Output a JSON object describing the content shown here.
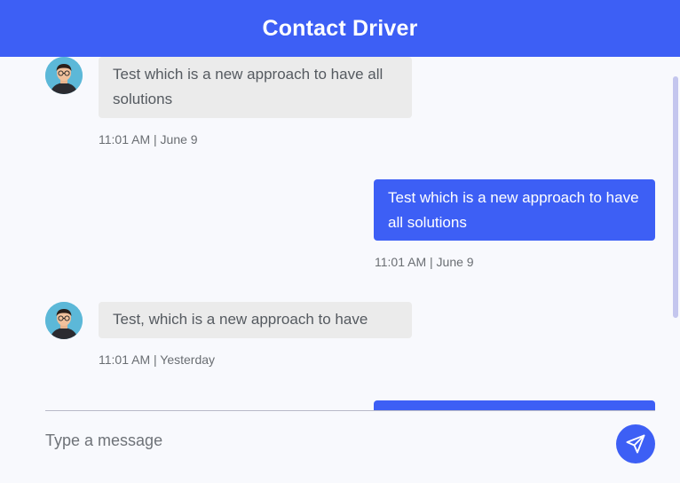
{
  "header": {
    "title": "Contact Driver"
  },
  "messages": [
    {
      "direction": "incoming",
      "text": "Test which is a new approach to have all solutions",
      "time": "11:01 AM | June 9"
    },
    {
      "direction": "outgoing",
      "text": "Test which is a new approach to have all solutions",
      "time": "11:01 AM | June 9"
    },
    {
      "direction": "incoming",
      "text": "Test, which is a new approach to have",
      "time": "11:01 AM | Yesterday"
    },
    {
      "direction": "outgoing",
      "text": "",
      "time": ""
    }
  ],
  "composer": {
    "placeholder": "Type a message",
    "send_icon": "send-icon"
  },
  "colors": {
    "accent": "#3d5ff5",
    "incoming_bubble": "#ebebeb",
    "background": "#f8f9fd",
    "scrollbar": "#c4c6ee"
  }
}
